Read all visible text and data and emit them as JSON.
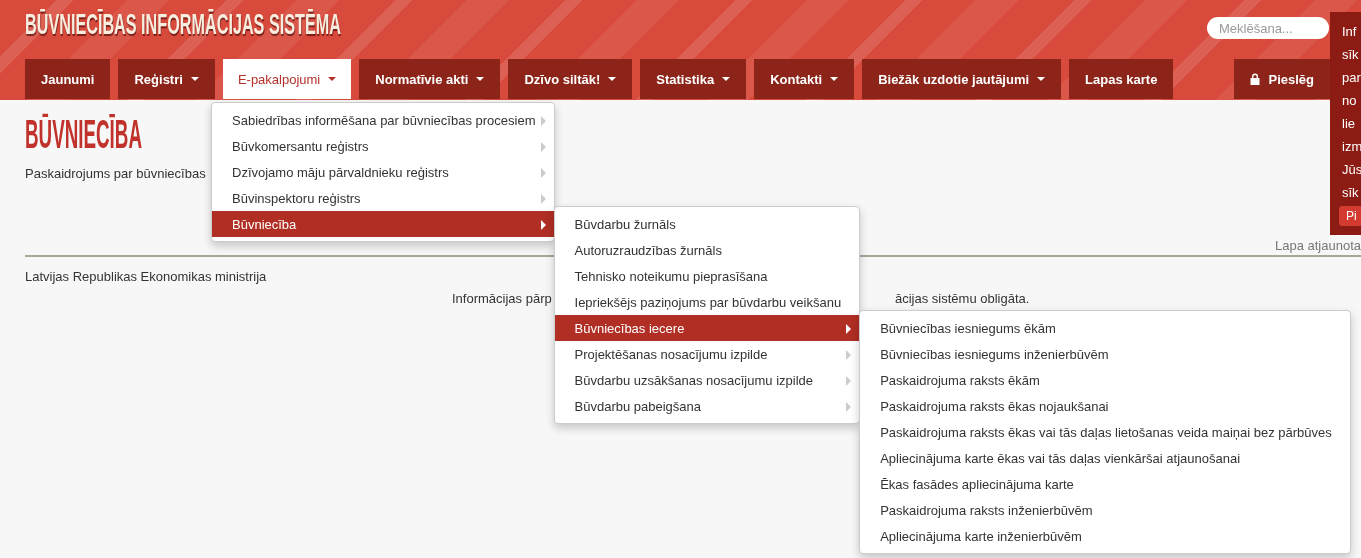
{
  "header": {
    "title": "BŪVNIECĪBAS INFORMĀCIJAS SISTĒMA",
    "search": {
      "placeholder": "Meklēšana..."
    }
  },
  "nav": [
    {
      "label": "Jaunumi",
      "dropdown": false,
      "selected": false
    },
    {
      "label": "Reģistri",
      "dropdown": true,
      "selected": false
    },
    {
      "label": "E-pakalpojumi",
      "dropdown": true,
      "selected": true
    },
    {
      "label": "Normatīvie akti",
      "dropdown": true,
      "selected": false
    },
    {
      "label": "Dzīvo siltāk!",
      "dropdown": true,
      "selected": false
    },
    {
      "label": "Statistika",
      "dropdown": true,
      "selected": false
    },
    {
      "label": "Kontakti",
      "dropdown": true,
      "selected": false
    },
    {
      "label": "Biežāk uzdotie jautājumi",
      "dropdown": true,
      "selected": false
    },
    {
      "label": "Lapas karte",
      "dropdown": false,
      "selected": false
    }
  ],
  "login": {
    "label": "Pieslēg"
  },
  "notice": {
    "lines": [
      "Inf",
      "sīk",
      "par",
      "no",
      "lie",
      "izm",
      "Jūs",
      "sīk"
    ],
    "button": "Pi"
  },
  "page": {
    "heading": "BŪVNIECĪBA",
    "intro": "Paskaidrojums par būvniecības",
    "updated": "Lapa atjaunota",
    "footer_org": "Latvijas Republikas Ekonomikas ministrija",
    "info_left": "Informācijas pārp",
    "info_right": "ācijas sistēmu obligāta."
  },
  "menu": {
    "items": [
      {
        "label": "Sabiedrības informēšana par būvniecības procesiem",
        "has_submenu": true,
        "selected": false
      },
      {
        "label": "Būvkomersantu reģistrs",
        "has_submenu": true,
        "selected": false
      },
      {
        "label": "Dzīvojamo māju pārvaldnieku reģistrs",
        "has_submenu": true,
        "selected": false
      },
      {
        "label": "Būvinspektoru reģistrs",
        "has_submenu": true,
        "selected": false
      },
      {
        "label": "Būvniecība",
        "has_submenu": true,
        "selected": true,
        "submenu": [
          {
            "label": "Būvdarbu žurnāls",
            "has_submenu": false,
            "selected": false
          },
          {
            "label": "Autoruzraudzības žurnāls",
            "has_submenu": false,
            "selected": false
          },
          {
            "label": "Tehnisko noteikumu pieprasīšana",
            "has_submenu": false,
            "selected": false
          },
          {
            "label": "Iepriekšējs paziņojums par būvdarbu veikšanu",
            "has_submenu": false,
            "selected": false
          },
          {
            "label": "Būvniecības iecere",
            "has_submenu": true,
            "selected": true,
            "submenu": [
              {
                "label": "Būvniecības iesniegums ēkām",
                "has_submenu": false,
                "selected": false
              },
              {
                "label": "Būvniecības iesniegums inženierbūvēm",
                "has_submenu": false,
                "selected": false
              },
              {
                "label": "Paskaidrojuma raksts ēkām",
                "has_submenu": false,
                "selected": false
              },
              {
                "label": "Paskaidrojuma raksts ēkas nojaukšanai",
                "has_submenu": false,
                "selected": false
              },
              {
                "label": "Paskaidrojuma raksts ēkas vai tās daļas lietošanas veida maiņai bez pārbūves",
                "has_submenu": false,
                "selected": false
              },
              {
                "label": "Apliecinājuma karte ēkas vai tās daļas vienkāršai atjaunošanai",
                "has_submenu": false,
                "selected": false
              },
              {
                "label": "Ēkas fasādes apliecinājuma karte",
                "has_submenu": false,
                "selected": false
              },
              {
                "label": "Paskaidrojuma raksts inženierbūvēm",
                "has_submenu": false,
                "selected": false
              },
              {
                "label": "Apliecinājuma karte inženierbūvēm",
                "has_submenu": false,
                "selected": false
              }
            ]
          },
          {
            "label": "Projektēšanas nosacījumu izpilde",
            "has_submenu": true,
            "selected": false
          },
          {
            "label": "Būvdarbu uzsākšanas nosacījumu izpilde",
            "has_submenu": true,
            "selected": false
          },
          {
            "label": "Būvdarbu pabeigšana",
            "has_submenu": true,
            "selected": false
          }
        ]
      }
    ]
  }
}
